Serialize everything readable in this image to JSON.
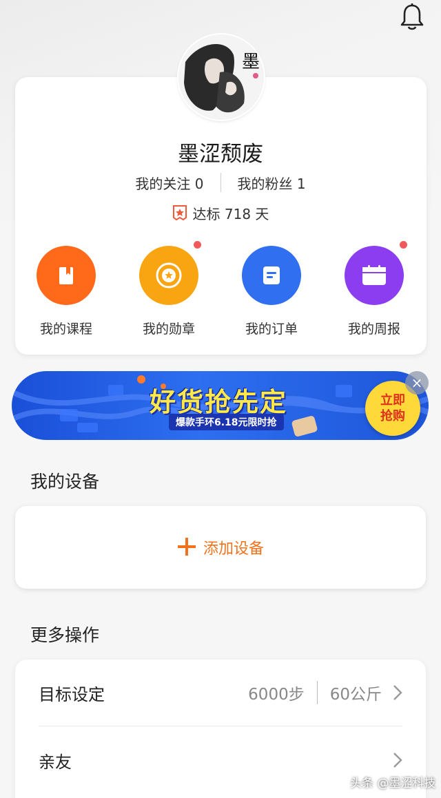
{
  "profile": {
    "username": "墨涩颓废",
    "following_label": "我的关注 0",
    "followers_label": "我的粉丝 1",
    "streak_label": "达标 718 天"
  },
  "quick_actions": [
    {
      "label": "我的课程",
      "color": "#ff6a1a",
      "icon": "book-icon"
    },
    {
      "label": "我的勋章",
      "color": "#f9a512",
      "icon": "medal-icon"
    },
    {
      "label": "我的订单",
      "color": "#2f6ff0",
      "icon": "order-icon"
    },
    {
      "label": "我的周报",
      "color": "#8c3df0",
      "icon": "report-icon"
    }
  ],
  "banner": {
    "title": "好货抢先定",
    "subtitle": "爆款手环6.18元限时抢",
    "cta_line1": "立即",
    "cta_line2": "抢购",
    "close_label": "×"
  },
  "devices": {
    "section_title": "我的设备",
    "add_label": "添加设备"
  },
  "more": {
    "section_title": "更多操作",
    "rows": [
      {
        "label": "目标设定",
        "steps": "6000步",
        "weight": "60公斤"
      },
      {
        "label": "亲友"
      }
    ]
  },
  "watermark": "头条 @墨涩科技",
  "colors": {
    "accent": "#f0731c",
    "badge_dot": "#f05a5a"
  }
}
